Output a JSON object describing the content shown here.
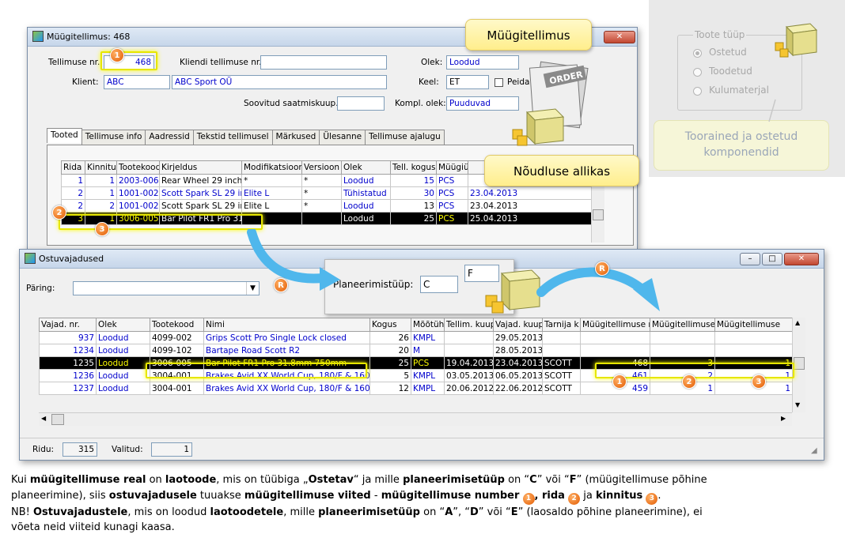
{
  "order_window": {
    "title": "Müügitellimus: 468",
    "fields": {
      "order_no_label": "Tellimuse nr.:",
      "order_no": "468",
      "client_order_label": "Kliendi tellimuse nr.:",
      "client_order": "",
      "status_label": "Olek:",
      "status": "Loodud",
      "client_label": "Klient:",
      "client_code": "ABC",
      "client_name": "ABC Sport OÜ",
      "lang_label": "Keel:",
      "lang": "ET",
      "hide_label": "Peida s",
      "wish_label": "Soovitud saatmiskuup.:",
      "wish": "",
      "kompl_label": "Kompl. olek:",
      "kompl": "Puuduvad"
    },
    "tabs": [
      "Tooted",
      "Tellimuse info",
      "Aadressid",
      "Tekstid tellimusel",
      "Märkused",
      "Ülesanne",
      "Tellimuse ajalugu"
    ],
    "columns": [
      "Rida",
      "Kinnitus",
      "Tootekood",
      "Kirjeldus",
      "Modifikatsioon",
      "Versioon",
      "Olek",
      "Tell. kogus",
      "Müügiül",
      ""
    ],
    "rows": [
      {
        "rida": "1",
        "kinnitus": "1",
        "code": "2003-006",
        "desc": "Rear Wheel 29 inch",
        "mod": "*",
        "ver": "*",
        "status": "Loodud",
        "qty": "15",
        "unit": "PCS",
        "date": ""
      },
      {
        "rida": "2",
        "kinnitus": "1",
        "code": "1001-002",
        "desc": "Scott Spark SL 29 inc",
        "mod": "Elite L",
        "ver": "*",
        "status": "Tühistatud",
        "qty": "30",
        "unit": "PCS",
        "date": "23.04.2013"
      },
      {
        "rida": "2",
        "kinnitus": "2",
        "code": "1001-002",
        "desc": "Scott Spark SL 29 inc",
        "mod": "Elite L",
        "ver": "*",
        "status": "Loodud",
        "qty": "13",
        "unit": "PCS",
        "date": "23.04.2013"
      },
      {
        "rida": "3",
        "kinnitus": "1",
        "code": "3006-005",
        "desc": "Bar Pilot FR1 Pro 31.",
        "mod": "",
        "ver": "",
        "status": "Loodud",
        "qty": "25",
        "unit": "PCS",
        "date": "25.04.2013"
      }
    ]
  },
  "purchase_window": {
    "title": "Ostuvajadused",
    "query_label": "Päring:",
    "query_value": "",
    "columns": [
      "Vajad. nr.",
      "Olek",
      "Tootekood",
      "Nimi",
      "Kogus",
      "Mõõtüh",
      "Tellim. kuup.",
      "Vajad. kuup.",
      "Tarnija k",
      "Müügitellimuse n",
      "Müügitellimuse",
      "Müügitellimuse"
    ],
    "rows": [
      {
        "nr": "937",
        "status": "Loodud",
        "code": "4099-002",
        "name": "Grips Scott Pro Single Lock closed",
        "qty": "26",
        "unit": "KMPL",
        "ord_date": "",
        "need_date": "29.05.2013",
        "supplier": "",
        "so_no": "",
        "so_row": "",
        "so_conf": ""
      },
      {
        "nr": "1234",
        "status": "Loodud",
        "code": "4099-102",
        "name": "Bartape Road Scott R2",
        "qty": "20",
        "unit": "M",
        "ord_date": "",
        "need_date": "28.05.2013",
        "supplier": "",
        "so_no": "",
        "so_row": "",
        "so_conf": ""
      },
      {
        "nr": "1235",
        "status": "Loodud",
        "code": "3006-005",
        "name": "Bar Pilot FR1 Pro 31.8mm 750mm",
        "qty": "25",
        "unit": "PCS",
        "ord_date": "19.04.2013",
        "need_date": "23.04.2013",
        "supplier": "SCOTT",
        "so_no": "468",
        "so_row": "3",
        "so_conf": "1"
      },
      {
        "nr": "1236",
        "status": "Loodud",
        "code": "3004-001",
        "name": "Brakes Avid XX World Cup, 180/F & 160",
        "qty": "5",
        "unit": "KMPL",
        "ord_date": "03.05.2013",
        "need_date": "06.05.2013",
        "supplier": "SCOTT",
        "so_no": "461",
        "so_row": "2",
        "so_conf": "1"
      },
      {
        "nr": "1237",
        "status": "Loodud",
        "code": "3004-001",
        "name": "Brakes Avid XX World Cup, 180/F & 160",
        "qty": "12",
        "unit": "KMPL",
        "ord_date": "20.06.2012",
        "need_date": "22.06.2012",
        "supplier": "SCOTT",
        "so_no": "459",
        "so_row": "1",
        "so_conf": "1"
      }
    ],
    "rows_label": "Ridu:",
    "rows_count": "315",
    "selected_label": "Valitud:",
    "selected_count": "1"
  },
  "planning_popup": {
    "label": "Planeerimistüüp:",
    "value1": "C",
    "value2": "F"
  },
  "callouts": {
    "order": "Müügitellimus",
    "demand_source": "Nõudluse allikas",
    "order_stamp": "ORDER"
  },
  "product_type_panel": {
    "legend": "Toote tüüp",
    "options": [
      "Ostetud",
      "Toodetud",
      "Kulumaterjal"
    ],
    "caption": "Toorained  ja ostetud komponendid"
  },
  "badges": {
    "b1": "1",
    "b2": "2",
    "b3": "3",
    "r": "R"
  },
  "explanation": {
    "l1_a": "Kui ",
    "l1_b": "müügitellimuse real",
    "l1_c": " on ",
    "l1_d": "laotoode",
    "l1_e": ", mis on tüübiga „",
    "l1_f": "Ostetav",
    "l1_g": "“ ja mille ",
    "l1_h": "planeerimisetüüp",
    "l1_i": " on “",
    "l1_j": "C",
    "l1_k": "” või “",
    "l1_l": "F",
    "l1_m": "” (müügitellimuse põhine",
    "l2_a": "planeerimine),  siis ",
    "l2_b": "ostuvajadusele",
    "l2_c": " tuuakse ",
    "l2_d": "müügitellimuse viited",
    "l2_e": "  - ",
    "l2_f": "müügitellimuse number",
    "l2_g": ", rida",
    "l2_h": " ja ",
    "l2_i": "kinnitus",
    "l2_j": ".",
    "l3_a": "NB! ",
    "l3_b": "Ostuvajadustele",
    "l3_c": ", mis on loodud ",
    "l3_d": "laotoodetele",
    "l3_e": ", mille ",
    "l3_f": "planeerimisetüüp",
    "l3_g": " on “",
    "l3_h": "A",
    "l3_i": "”, “",
    "l3_j": "D",
    "l3_k": "” või “",
    "l3_l": "E",
    "l3_m": "” (laosaldo põhine planeerimine), ei",
    "l4_a": "võeta neid viiteid kunagi kaasa."
  }
}
